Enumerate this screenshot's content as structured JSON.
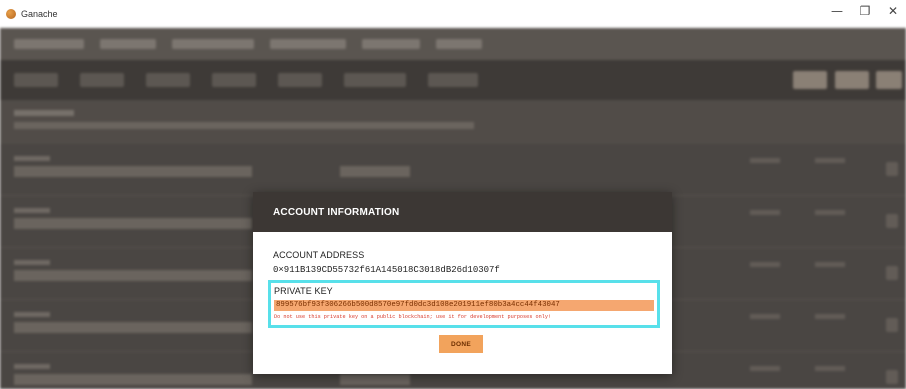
{
  "window": {
    "title": "Ganache",
    "minimize_glyph": "—",
    "maximize_glyph": "❐",
    "close_glyph": "✕"
  },
  "modal": {
    "title": "ACCOUNT INFORMATION",
    "address_label": "ACCOUNT ADDRESS",
    "address_value": "0×911B139CD55732f61A145018C3018dB26d10307f",
    "private_key_label": "PRIVATE KEY",
    "private_key_value": "899576bf93f306266b500d8570e97fd0dc3d108e201911ef80b3a4cc44f43047",
    "warning": "Do not use this private key on a public blockchain; use it for development purposes only!",
    "done_label": "DONE"
  },
  "colors": {
    "header_bg": "#3c3734",
    "highlight_border": "#58e0ea",
    "key_highlight": "#f5a770",
    "warning_text": "#d83a2b",
    "done_button": "#f2a35c"
  }
}
